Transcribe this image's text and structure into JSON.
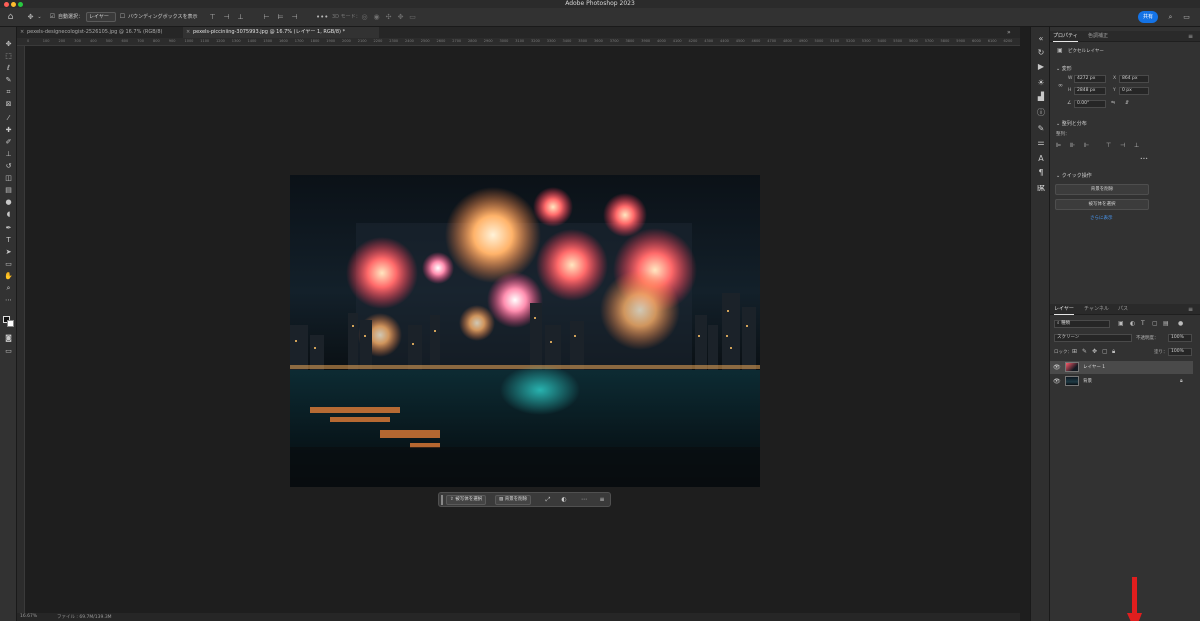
{
  "window": {
    "title": "Adobe Photoshop 2023"
  },
  "options_bar": {
    "auto_select_label": "自動選択：",
    "auto_select_value": "レイヤー",
    "bounding_box_label": "バウンディングボックスを表示",
    "mode_3d_label": "3D モード：",
    "share_label": "共有"
  },
  "tabs": [
    {
      "label": "pexels-designecologist-2526105.jpg @ 16.7% (RGB/8)"
    },
    {
      "label": "pexels-picciniing-3075993.jpg @ 16.7% (レイヤー 1, RGB/8) *"
    }
  ],
  "ruler_ticks": [
    "0",
    "100",
    "200",
    "300",
    "400",
    "500",
    "600",
    "700",
    "800",
    "900",
    "1000",
    "1100",
    "1200",
    "1300",
    "1400",
    "1500",
    "1600",
    "1700",
    "1800",
    "1900",
    "2000",
    "2100",
    "2200",
    "2300",
    "2400",
    "2500",
    "2600",
    "2700",
    "2800",
    "2900",
    "3000",
    "3100",
    "3200",
    "3300",
    "3400",
    "3500",
    "3600",
    "3700",
    "3800",
    "3900",
    "4000",
    "4100",
    "4200",
    "4300",
    "4400",
    "4500",
    "4600",
    "4700",
    "4800",
    "4900",
    "5000",
    "5100",
    "5200",
    "5300",
    "5400",
    "5500",
    "5600",
    "5700",
    "5800",
    "5900",
    "6000",
    "6100",
    "6200"
  ],
  "statusbar": {
    "zoom": "16.67%",
    "info": "ファイル : 69.7M/139.3M"
  },
  "context_bar": {
    "select_subject": "被写体を選択",
    "remove_bg": "背景を削除"
  },
  "properties": {
    "tabs": [
      "プロパティ",
      "色調補正"
    ],
    "layer_type": "ピクセルレイヤー",
    "transform": {
      "title": "変形",
      "w_label": "W",
      "w_value": "4272 px",
      "h_label": "H",
      "h_value": "2848 px",
      "x_label": "X",
      "x_value": "864 px",
      "y_label": "Y",
      "y_value": "0 px",
      "angle": "0.00°"
    },
    "align": {
      "title": "整列と分布",
      "sub": "整列：",
      "more": "•••"
    },
    "quick": {
      "title": "クイック操作",
      "btn1": "背景を削除",
      "btn2": "被写体を選択",
      "more": "さらに表示"
    }
  },
  "layers": {
    "tabs": [
      "レイヤー",
      "チャンネル",
      "パス"
    ],
    "filter": "種類",
    "blend": "スクリーン",
    "opacity_label": "不透明度：",
    "opacity": "100%",
    "lock_label": "ロック：",
    "fill_label": "塗り：",
    "fill": "100%",
    "items": [
      {
        "name": "レイヤー 1"
      },
      {
        "name": "背景"
      }
    ]
  },
  "colors": {
    "accent": "#1473e6",
    "arrow": "#e01e1e"
  }
}
